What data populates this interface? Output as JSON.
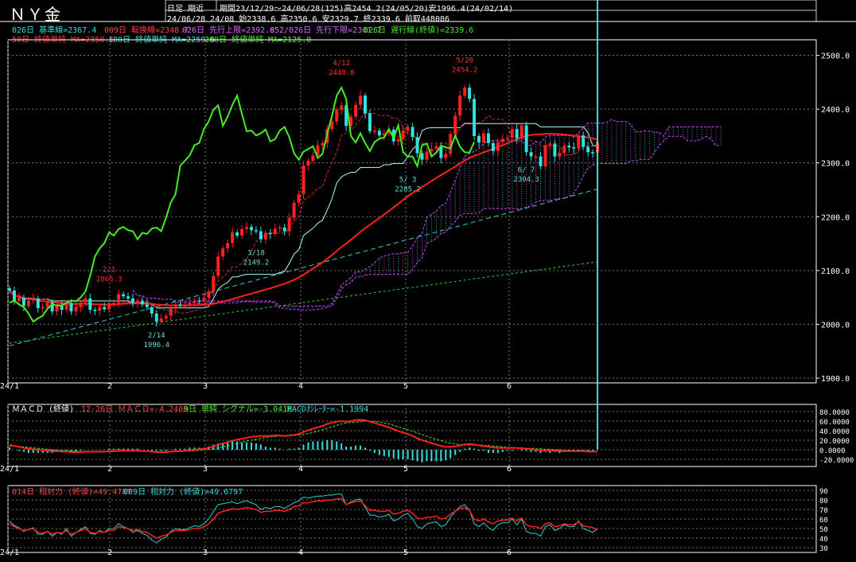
{
  "header": {
    "title": "ＮＹ金",
    "mode": "日足 期近",
    "period_line": "期間23/12/29～24/06/28(125)高2454.2(24/05/20)安1996.4(24/02/14)",
    "last_bar_line": "24/06/28 24/08 始2338.6 高2350.6 安2329.7 終2339.6 前取448086"
  },
  "indicator_lines": {
    "ichimoku_a": "026日 基準線=2367.4",
    "ichimoku_b": "009日 転換線=2348.7",
    "ichimoku_c": "026日 先行上限=2392.8",
    "ichimoku_d": "052/026日 先行下限=2301.7",
    "ichimoku_e": "026日 遅行線(終値)=2339.6",
    "ma_a": "50日 終値単純 MA=2350.6",
    "ma_b": "100日 終値単純 MA=2259.6",
    "ma_c": "200日 終値単純 MA=2125.0",
    "macd_title": "ＭＡＣＤ (終値)",
    "macd_a": "12-26日 ＭＡＣＤ=-4.2408",
    "macd_b": "9日 単純 シグナル=-3.0416",
    "macd_c": "MACDｵｼﾚｰﾀｰ=-1.1994",
    "rsi_a": "014日 相対力 (終値)=49.4787",
    "rsi_b": "009日 相対力 (終値)=49.6797"
  },
  "colors": {
    "background": "#000000",
    "up_candle": "#ff2020",
    "down_candle": "#33e0e0",
    "ma50": "#ff2020",
    "ma100": "#33cccc",
    "ma200": "#22cc22",
    "chikou": "#44ee22",
    "kijun": "#aaffff",
    "tenkan": "#ff3333",
    "cloud": "#cc44ff",
    "annotation": "#ff3030",
    "annotation_low": "#66dddd"
  },
  "chart_data": [
    {
      "type": "candlestick",
      "ylim": [
        1900,
        2520
      ],
      "yticks": [
        "2500.0",
        "2400.0",
        "2300.0",
        "2200.0",
        "2100.0",
        "2000.0",
        "1900.0"
      ],
      "xticks": [
        "24/1",
        "2",
        "3",
        "4",
        "5",
        "6"
      ],
      "annotations": [
        {
          "date": "2/1",
          "value": "2065.3",
          "kind": "high"
        },
        {
          "date": "2/14",
          "value": "1996.4",
          "kind": "low"
        },
        {
          "date": "3/18",
          "value": "2149.2",
          "kind": "low"
        },
        {
          "date": "4/12",
          "value": "2448.8",
          "kind": "high"
        },
        {
          "date": "5/ 3",
          "value": "2285.2",
          "kind": "low"
        },
        {
          "date": "5/20",
          "value": "2454.2",
          "kind": "high"
        },
        {
          "date": "6/ 7",
          "value": "2304.3",
          "kind": "low"
        }
      ],
      "close": [
        2063,
        2043,
        2050,
        2034,
        2044,
        2048,
        2030,
        2032,
        2041,
        2024,
        2035,
        2027,
        2040,
        2024,
        2032,
        2041,
        2048,
        2027,
        2025,
        2032,
        2028,
        2039,
        2040,
        2056,
        2052,
        2048,
        2040,
        2044,
        2037,
        2032,
        2020,
        2005,
        2011,
        2016,
        2029,
        2037,
        2035,
        2035,
        2040,
        2044,
        2043,
        2050,
        2061,
        2090,
        2126,
        2141,
        2151,
        2171,
        2165,
        2177,
        2181,
        2175,
        2173,
        2158,
        2170,
        2168,
        2178,
        2180,
        2173,
        2198,
        2226,
        2242,
        2295,
        2304,
        2314,
        2333,
        2337,
        2363,
        2377,
        2399,
        2407,
        2369,
        2386,
        2408,
        2425,
        2392,
        2359,
        2360,
        2351,
        2355,
        2362,
        2340,
        2344,
        2360,
        2367,
        2348,
        2318,
        2306,
        2321,
        2326,
        2331,
        2309,
        2317,
        2354,
        2388,
        2425,
        2440,
        2419,
        2350,
        2338,
        2355,
        2337,
        2322,
        2339,
        2345,
        2347,
        2363,
        2346,
        2370,
        2320,
        2312,
        2312,
        2294,
        2333,
        2336,
        2312,
        2319,
        2332,
        2329,
        2327,
        2351,
        2330,
        2320,
        2319,
        2339
      ]
    },
    {
      "type": "line",
      "name": "MACD",
      "ylim": [
        -25,
        85
      ],
      "yticks": [
        "80.0000",
        "60.0000",
        "40.0000",
        "20.0000",
        "0.0000",
        "-20.0000"
      ],
      "macd": [
        10,
        8,
        6,
        4,
        2,
        1,
        0,
        -1,
        -2,
        -3,
        -3,
        -4,
        -4,
        -5,
        -5,
        -5,
        -4,
        -4,
        -4,
        -4,
        -4,
        -3,
        -3,
        -2,
        -2,
        -2,
        -2,
        -2,
        -3,
        -3,
        -4,
        -5,
        -5,
        -5,
        -4,
        -3,
        -3,
        -2,
        -1,
        0,
        1,
        2,
        4,
        7,
        10,
        13,
        16,
        19,
        21,
        23,
        25,
        27,
        28,
        29,
        29,
        29,
        30,
        30,
        29,
        30,
        31,
        33,
        37,
        41,
        44,
        47,
        50,
        54,
        57,
        59,
        60,
        59,
        60,
        62,
        63,
        62,
        59,
        56,
        53,
        50,
        47,
        43,
        39,
        36,
        33,
        29,
        24,
        20,
        17,
        14,
        11,
        8,
        6,
        6,
        7,
        9,
        11,
        12,
        11,
        9,
        8,
        6,
        5,
        4,
        4,
        4,
        4,
        4,
        3,
        2,
        1,
        0,
        -1,
        -1,
        -2,
        -2,
        -3,
        -3,
        -3,
        -3,
        -3,
        -3,
        -4,
        -4,
        -4
      ],
      "signal": [
        8,
        8,
        7,
        6,
        5,
        4,
        3,
        2,
        1,
        0,
        -1,
        -2,
        -2,
        -3,
        -3,
        -4,
        -4,
        -4,
        -4,
        -4,
        -4,
        -4,
        -4,
        -3,
        -3,
        -3,
        -3,
        -3,
        -3,
        -3,
        -3,
        -4,
        -4,
        -4,
        -4,
        -4,
        -4,
        -3,
        -3,
        -2,
        -1,
        0,
        1,
        2,
        4,
        6,
        8,
        11,
        13,
        16,
        18,
        20,
        22,
        24,
        26,
        27,
        28,
        29,
        29,
        29,
        30,
        31,
        32,
        34,
        36,
        39,
        42,
        45,
        48,
        51,
        54,
        56,
        57,
        58,
        59,
        60,
        60,
        59,
        58,
        56,
        54,
        51,
        48,
        45,
        42,
        39,
        35,
        32,
        28,
        25,
        22,
        19,
        16,
        14,
        12,
        11,
        10,
        10,
        10,
        10,
        9,
        9,
        8,
        7,
        6,
        5,
        5,
        4,
        4,
        3,
        3,
        2,
        2,
        1,
        1,
        0,
        0,
        -1,
        -1,
        -2,
        -2,
        -2,
        -3,
        -3
      ]
    },
    {
      "type": "line",
      "name": "RSI",
      "ylim": [
        30,
        90
      ],
      "yticks": [
        "90",
        "80",
        "70",
        "60",
        "50",
        "40",
        "30"
      ],
      "rsi14": [
        55,
        52,
        50,
        48,
        49,
        50,
        46,
        45,
        47,
        44,
        46,
        45,
        48,
        44,
        46,
        48,
        50,
        46,
        45,
        47,
        46,
        48,
        48,
        52,
        51,
        50,
        48,
        49,
        47,
        46,
        43,
        40,
        42,
        43,
        46,
        48,
        48,
        48,
        49,
        50,
        50,
        52,
        55,
        60,
        66,
        68,
        69,
        71,
        70,
        71,
        72,
        71,
        70,
        67,
        68,
        68,
        69,
        69,
        68,
        70,
        73,
        74,
        77,
        77,
        78,
        79,
        79,
        80,
        80,
        81,
        81,
        75,
        77,
        78,
        79,
        74,
        69,
        69,
        68,
        68,
        69,
        65,
        66,
        68,
        69,
        66,
        61,
        60,
        62,
        62,
        63,
        60,
        61,
        65,
        68,
        71,
        72,
        69,
        60,
        58,
        60,
        57,
        55,
        58,
        59,
        59,
        61,
        58,
        61,
        54,
        52,
        52,
        50,
        55,
        56,
        52,
        53,
        55,
        54,
        54,
        57,
        53,
        52,
        51,
        49
      ],
      "rsi9": [
        58,
        53,
        51,
        47,
        49,
        51,
        44,
        44,
        47,
        42,
        46,
        44,
        50,
        42,
        46,
        49,
        52,
        45,
        44,
        48,
        46,
        50,
        50,
        55,
        52,
        50,
        46,
        48,
        45,
        43,
        38,
        35,
        39,
        41,
        47,
        50,
        49,
        49,
        51,
        53,
        52,
        55,
        60,
        68,
        75,
        76,
        77,
        78,
        76,
        78,
        79,
        77,
        75,
        70,
        72,
        71,
        73,
        73,
        71,
        74,
        77,
        79,
        83,
        82,
        83,
        84,
        84,
        85,
        85,
        86,
        86,
        75,
        78,
        80,
        81,
        72,
        64,
        64,
        62,
        63,
        65,
        58,
        60,
        64,
        66,
        60,
        52,
        50,
        55,
        56,
        57,
        52,
        54,
        62,
        68,
        73,
        75,
        69,
        55,
        52,
        56,
        51,
        48,
        54,
        56,
        56,
        60,
        54,
        60,
        47,
        45,
        45,
        42,
        52,
        54,
        48,
        50,
        54,
        52,
        52,
        58,
        50,
        48,
        46,
        50
      ]
    }
  ]
}
